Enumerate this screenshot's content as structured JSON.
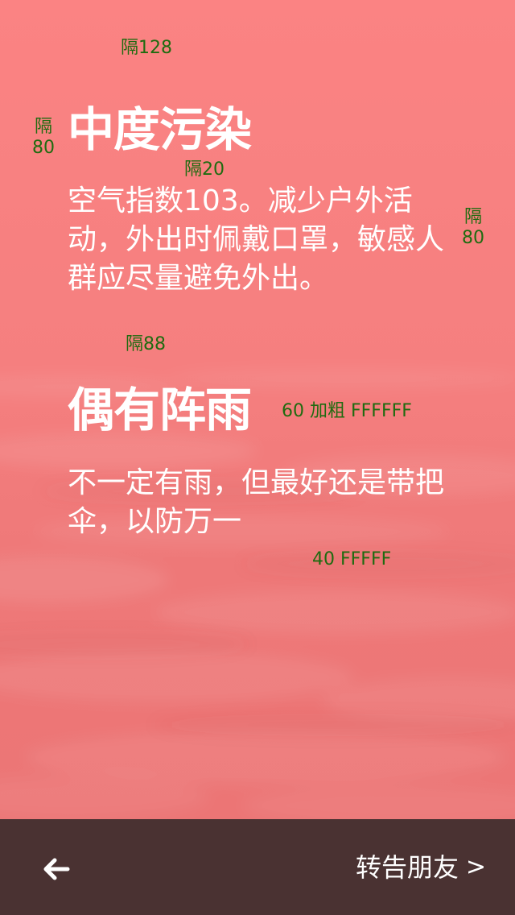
{
  "colors": {
    "background": "#f57f7f",
    "bottom_bar": "#4a3232",
    "text": "#ffffff",
    "annotation": "#1f6b10"
  },
  "annotations": {
    "gap_top": "隔128",
    "gap_left_line1": "隔",
    "gap_left_line2": "80",
    "gap_title_para": "隔20",
    "gap_right_line1": "隔",
    "gap_right_line2": "80",
    "gap_sections": "隔88",
    "heading_spec": "60  加粗  FFFFFF",
    "body_spec": "40  FFFFF"
  },
  "sections": [
    {
      "title": "中度污染",
      "text": "空气指数103。减少户外活动，外出时佩戴口罩，敏感人群应尽量避免外出。"
    },
    {
      "title": "偶有阵雨",
      "text": "不一定有雨，但最好还是带把伞，以防万一"
    }
  ],
  "bottom_bar": {
    "back_icon": "arrow-left-icon",
    "share_label": "转告朋友",
    "share_chevron": ">"
  }
}
